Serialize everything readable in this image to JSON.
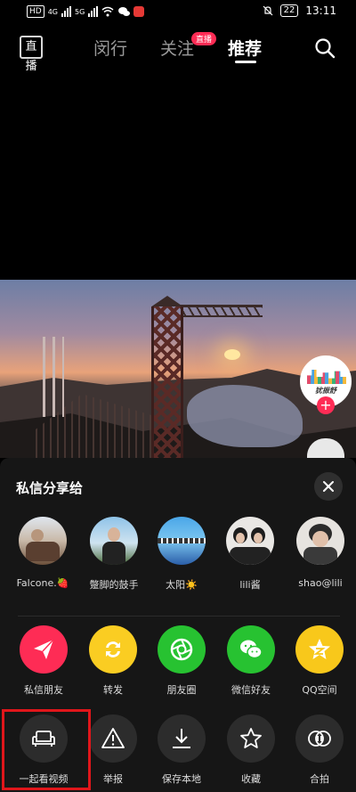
{
  "status_bar": {
    "hd": "HD",
    "net1": "4G",
    "net2": "5G",
    "battery": "22",
    "time": "13:11"
  },
  "top_nav": {
    "live_icon_text": "直播",
    "tabs": [
      {
        "label": "闵行"
      },
      {
        "label": "关注"
      },
      {
        "label": "推荐"
      }
    ],
    "live_badge": "直播"
  },
  "creator": {
    "avatar_caption": "犹振舒"
  },
  "share_sheet": {
    "title": "私信分享给",
    "friends": [
      {
        "name": "Falcone.🍓"
      },
      {
        "name": "蹩脚的鼓手"
      },
      {
        "name": "太阳☀️"
      },
      {
        "name": "lili酱"
      },
      {
        "name": "shao@lili"
      }
    ],
    "apps": [
      {
        "label": "私信朋友",
        "color": "#fe2c55",
        "icon": "send-icon"
      },
      {
        "label": "转发",
        "color": "#facd22",
        "icon": "repost-icon"
      },
      {
        "label": "朋友圈",
        "color": "#27c231",
        "icon": "moments-icon"
      },
      {
        "label": "微信好友",
        "color": "#27c231",
        "icon": "wechat-icon"
      },
      {
        "label": "QQ空间",
        "color": "#f8c81b",
        "icon": "qzone-icon"
      }
    ],
    "actions": [
      {
        "label": "一起看视频",
        "icon": "sofa-icon"
      },
      {
        "label": "举报",
        "icon": "warning-icon"
      },
      {
        "label": "保存本地",
        "icon": "download-icon"
      },
      {
        "label": "收藏",
        "icon": "star-icon"
      },
      {
        "label": "合拍",
        "icon": "duet-icon"
      }
    ]
  }
}
